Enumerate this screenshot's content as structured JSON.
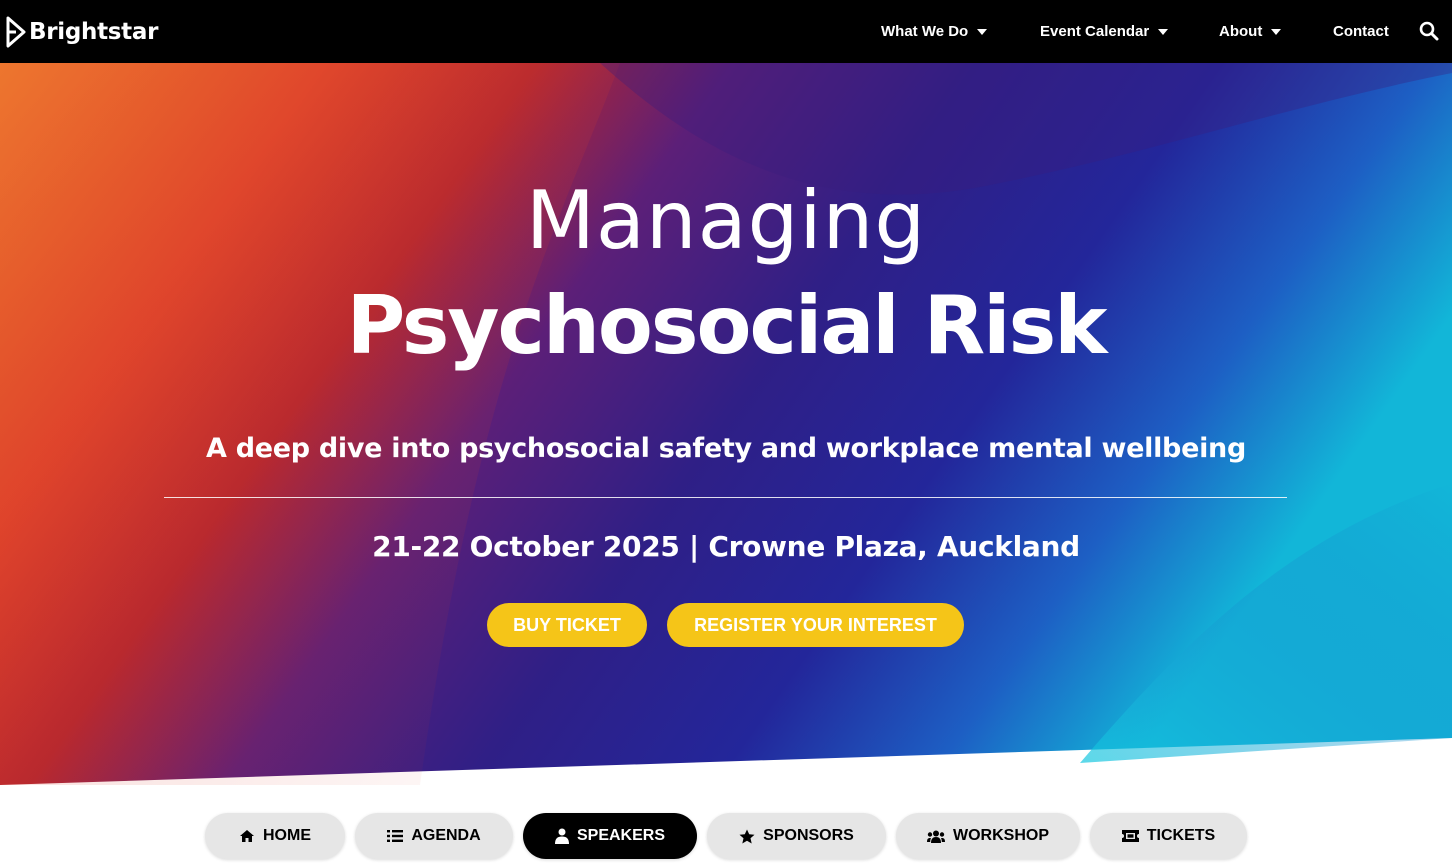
{
  "header": {
    "logo_text": "Brightstar",
    "nav": [
      {
        "label": "What We Do",
        "has_dropdown": true
      },
      {
        "label": "Event Calendar",
        "has_dropdown": true
      },
      {
        "label": "About",
        "has_dropdown": true
      },
      {
        "label": "Contact",
        "has_dropdown": false
      }
    ],
    "search_icon": "search-icon"
  },
  "hero": {
    "title_line1": "Managing",
    "title_line2": "Psychosocial Risk",
    "subtitle": "A deep dive into psychosocial safety and workplace mental wellbeing",
    "date_location": "21-22 October 2025 | Crowne Plaza, Auckland",
    "buy_label": "BUY TICKET",
    "register_label": "REGISTER YOUR INTEREST",
    "button_color": "#f5c518",
    "gradient_colors": [
      "#e8672a",
      "#d42f2a",
      "#4a1f8a",
      "#2a1f8f",
      "#1a4fbf",
      "#12b8d8"
    ]
  },
  "tabs": [
    {
      "label": "HOME",
      "icon": "home-icon",
      "active": false
    },
    {
      "label": "AGENDA",
      "icon": "list-icon",
      "active": false
    },
    {
      "label": "SPEAKERS",
      "icon": "user-icon",
      "active": true
    },
    {
      "label": "SPONSORS",
      "icon": "star-icon",
      "active": false
    },
    {
      "label": "WORKSHOP",
      "icon": "users-icon",
      "active": false
    },
    {
      "label": "TICKETS",
      "icon": "ticket-icon",
      "active": false
    }
  ]
}
